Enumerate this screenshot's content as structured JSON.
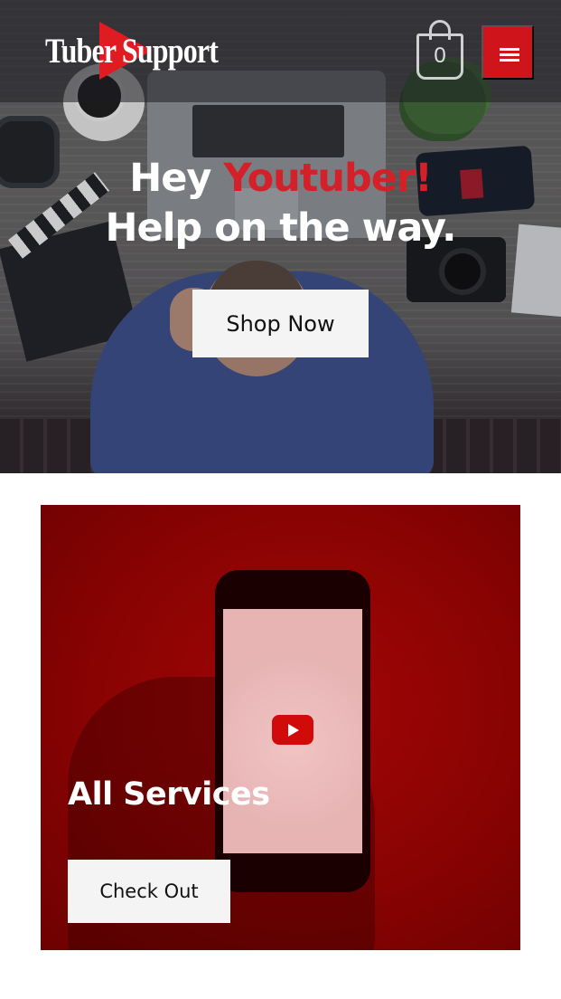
{
  "header": {
    "logo_text": "Tuber Support",
    "cart_count": "0",
    "menu_icon": "hamburger-icon",
    "cart_icon": "shopping-bag-icon"
  },
  "hero": {
    "title_line1_prefix": "Hey ",
    "title_line1_accent": "Youtuber!",
    "title_line2": "Help on the way.",
    "cta_label": "Shop Now"
  },
  "services": {
    "title": "All Services",
    "cta_label": "Check Out",
    "icon": "youtube-play-icon"
  },
  "colors": {
    "brand_red": "#d0141b",
    "accent_text": "#d42028",
    "card_red": "#8a0303",
    "button_bg": "#f4f4f4"
  }
}
